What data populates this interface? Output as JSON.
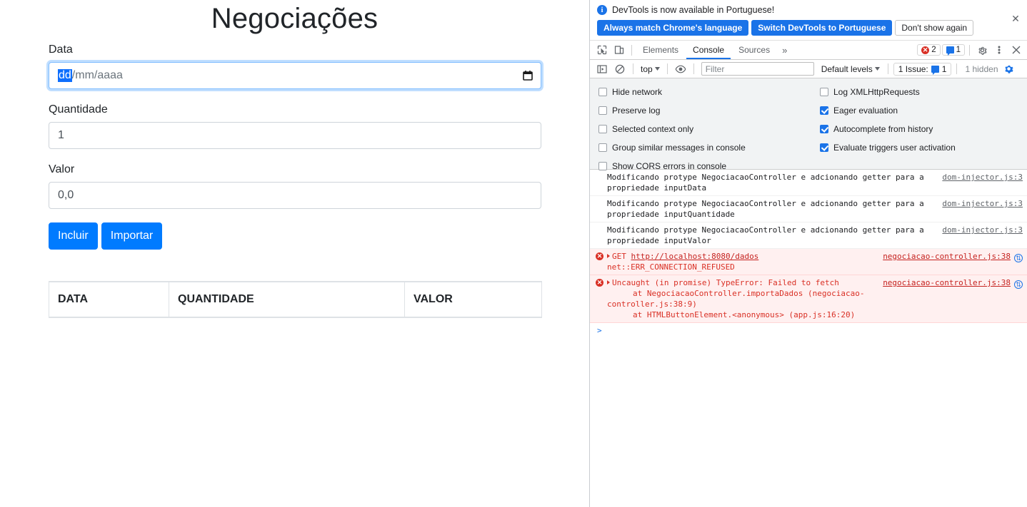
{
  "page": {
    "title": "Negociações",
    "fields": [
      {
        "label": "Data",
        "type": "date",
        "placeholder_day": "dd",
        "placeholder_rest": "/mm/aaaa",
        "icon": "calendar-icon"
      },
      {
        "label": "Quantidade",
        "type": "number",
        "value": "1"
      },
      {
        "label": "Valor",
        "type": "text",
        "value": "0,0"
      }
    ],
    "buttons": [
      {
        "label": "Incluir",
        "name": "incluir-button"
      },
      {
        "label": "Importar",
        "name": "importar-button"
      }
    ],
    "table": {
      "columns": [
        "DATA",
        "QUANTIDADE",
        "VALOR"
      ],
      "rows": []
    },
    "accent_color": "#007bff"
  },
  "devtools": {
    "banner": {
      "icon": "info-icon",
      "message": "DevTools is now available in Portuguese!",
      "buttons": [
        {
          "label": "Always match Chrome's language",
          "style": "primary"
        },
        {
          "label": "Switch DevTools to Portuguese",
          "style": "primary"
        },
        {
          "label": "Don't show again",
          "style": "plain"
        }
      ],
      "close_icon": "close-icon"
    },
    "toolbar": {
      "inspect_icon": "inspect-element-icon",
      "device_icon": "device-toolbar-icon",
      "tabs": [
        {
          "label": "Elements",
          "active": false
        },
        {
          "label": "Console",
          "active": true
        },
        {
          "label": "Sources",
          "active": false
        }
      ],
      "more_tabs_icon": "chevron-double-right-icon",
      "error_count": "2",
      "message_count": "1",
      "settings_icon": "gear-icon",
      "menu_icon": "kebab-menu-icon",
      "close_icon": "close-icon"
    },
    "filterbar": {
      "sidebar_icon": "console-sidebar-icon",
      "clear_icon": "clear-console-icon",
      "context": "top",
      "eye_icon": "live-expression-icon",
      "filter_placeholder": "Filter",
      "filter_value": "",
      "levels": "Default levels",
      "issue_label": "1 Issue:",
      "issue_count": "1",
      "hidden_label": "1 hidden",
      "settings_gear_icon": "console-settings-gear-icon"
    },
    "settings": {
      "column_left": [
        {
          "label": "Hide network",
          "checked": false
        },
        {
          "label": "Preserve log",
          "checked": false
        },
        {
          "label": "Selected context only",
          "checked": false
        },
        {
          "label": "Group similar messages in console",
          "checked": false
        },
        {
          "label": "Show CORS errors in console",
          "checked": false
        }
      ],
      "column_right": [
        {
          "label": "Log XMLHttpRequests",
          "checked": false
        },
        {
          "label": "Eager evaluation",
          "checked": true
        },
        {
          "label": "Autocomplete from history",
          "checked": true
        },
        {
          "label": "Evaluate triggers user activation",
          "checked": true
        }
      ]
    },
    "console_messages": [
      {
        "type": "log",
        "line1": "Modificando protype NegociacaoController e adcionando getter para a",
        "line2": "propriedade  inputData",
        "source": "dom-injector.js:3"
      },
      {
        "type": "log",
        "line1": "Modificando protype NegociacaoController e adcionando getter para a",
        "line2": "propriedade  inputQuantidade",
        "source": "dom-injector.js:3"
      },
      {
        "type": "log",
        "line1": "Modificando protype NegociacaoController e adcionando getter para a",
        "line2": "propriedade  inputValor",
        "source": "dom-injector.js:3"
      },
      {
        "type": "error",
        "prefix": "GET ",
        "url": "http://localhost:8080/dados",
        "line2": "net::ERR_CONNECTION_REFUSED",
        "source": "negociacao-controller.js:38"
      },
      {
        "type": "error",
        "line1": "Uncaught (in promise) TypeError: Failed to fetch",
        "stack": [
          "at NegociacaoController.importaDados (negociacao-controller.js:38:9)",
          "at HTMLButtonElement.<anonymous> (app.js:16:20)"
        ],
        "source": "negociacao-controller.js:38"
      }
    ],
    "prompt_symbol": ">"
  }
}
